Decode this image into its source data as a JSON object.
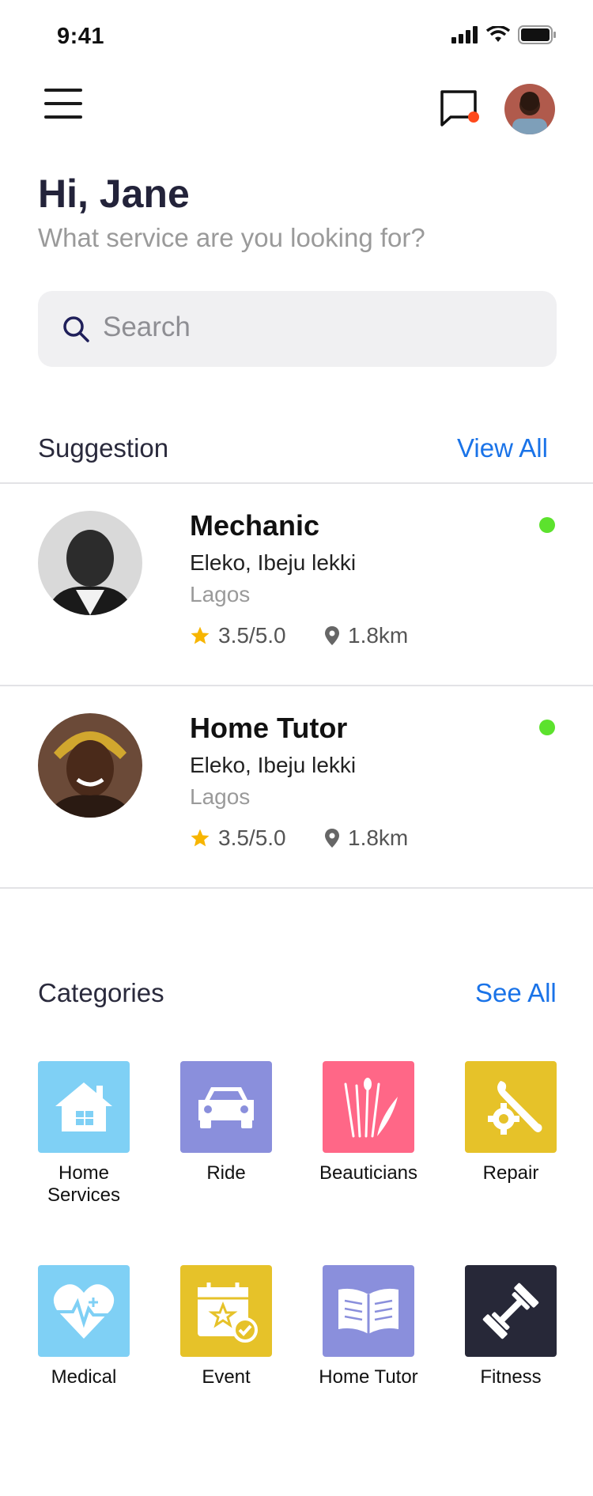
{
  "status_bar": {
    "time": "9:41"
  },
  "header": {
    "greeting": "Hi, Jane",
    "subtitle": "What service are you looking for?"
  },
  "search": {
    "placeholder": "Search"
  },
  "suggestion": {
    "title": "Suggestion",
    "view_all": "View All",
    "items": [
      {
        "title": "Mechanic",
        "address": "Eleko, Ibeju lekki",
        "city": "Lagos",
        "rating": "3.5/5.0",
        "distance": "1.8km",
        "online": true
      },
      {
        "title": "Home Tutor",
        "address": "Eleko, Ibeju lekki",
        "city": "Lagos",
        "rating": "3.5/5.0",
        "distance": "1.8km",
        "online": true
      }
    ]
  },
  "categories": {
    "title": "Categories",
    "see_all": "See All",
    "items": [
      {
        "label": "Home Services",
        "color": "#7fd0f5",
        "icon": "house-icon"
      },
      {
        "label": "Ride",
        "color": "#8a8fdc",
        "icon": "car-icon"
      },
      {
        "label": "Beauticians",
        "color": "#ff6787",
        "icon": "brushes-icon"
      },
      {
        "label": "Repair",
        "color": "#e6c229",
        "icon": "wrench-gear-icon"
      },
      {
        "label": "Medical",
        "color": "#7fd0f5",
        "icon": "heart-pulse-icon"
      },
      {
        "label": "Event",
        "color": "#e6c229",
        "icon": "calendar-star-icon"
      },
      {
        "label": "Home Tutor",
        "color": "#8a8fdc",
        "icon": "open-book-icon"
      },
      {
        "label": "Fitness",
        "color": "#272838",
        "icon": "dumbbell-icon"
      }
    ]
  },
  "colors": {
    "accent": "#1a73e8",
    "online": "#5ce22d",
    "notification": "#ff4a1c",
    "star": "#f7b500"
  }
}
